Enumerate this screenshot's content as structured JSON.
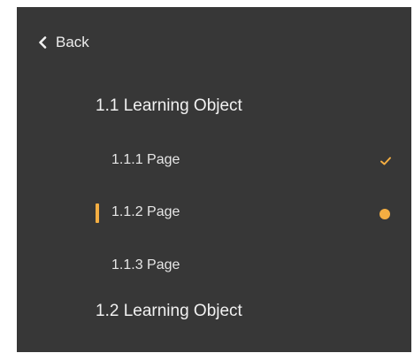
{
  "nav": {
    "back_label": "Back",
    "back_icon": "chevron-left-icon"
  },
  "outline": {
    "learning_objects": [
      {
        "label": "1.1 Learning Object",
        "pages": [
          {
            "label": "1.1.1 Page",
            "status": "completed",
            "status_icon": "check-icon"
          },
          {
            "label": "1.1.2 Page",
            "status": "current",
            "status_icon": "dot-icon"
          },
          {
            "label": "1.1.3 Page",
            "status": "not-started"
          }
        ]
      },
      {
        "label": "1.2 Learning Object"
      }
    ]
  },
  "colors": {
    "background": "#373737",
    "text": "#e9e9e9",
    "accent": "#f4ae42"
  }
}
